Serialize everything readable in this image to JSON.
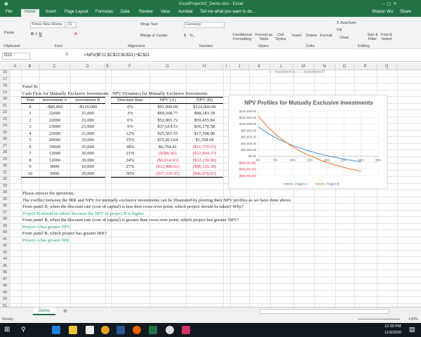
{
  "window": {
    "title": "ExcelProject#2_Demo.xlsx - Excel",
    "user": "Sharon Wu",
    "share": "Share"
  },
  "ribbon_tabs": [
    "File",
    "Home",
    "Insert",
    "Page Layout",
    "Formulas",
    "Data",
    "Review",
    "View",
    "Acrobat"
  ],
  "tell_me": "Tell me what you want to do...",
  "ribbon": {
    "paste": "Paste",
    "font_name": "Times New Roma",
    "font_size": "11",
    "wrap": "Wrap Text",
    "merge": "Merge & Center",
    "number_format": "Currency",
    "conditional": "Conditional Formatting",
    "format_table": "Format as Table",
    "cell_styles": "Cell Styles",
    "insert": "Insert",
    "delete": "Delete",
    "format": "Format",
    "autosum": "AutoSum",
    "fill": "Fill",
    "clear": "Clear",
    "sort": "Sort & Filter",
    "find": "Find & Select",
    "groups": [
      "Clipboard",
      "Font",
      "Alignment",
      "Number",
      "Styles",
      "Cells",
      "Editing"
    ]
  },
  "formula_bar": {
    "name_box": "G21",
    "formula": "=NPV($F21,$C$22:$C$31)+$C$21"
  },
  "columns": [
    "A",
    "B",
    "C",
    "D",
    "E",
    "F",
    "G",
    "H",
    "I",
    "J",
    "K",
    "L",
    "M",
    "N",
    "O",
    "P",
    "Q"
  ],
  "rows_start": 16,
  "rows_end": 51,
  "panel": {
    "label": "Panel B:",
    "left_title": "Cash Flow for Mutually Exclusive Investments",
    "right_title": "NPV Dynamics for Mutually Exclusive Investments",
    "left_headers": [
      "Year",
      "Investment A",
      "Investment B"
    ],
    "right_headers": [
      "Discount Rate",
      "NPV (A)",
      "NPV (B)"
    ],
    "rows": [
      [
        "0",
        "-$80,000",
        "-$120,000",
        "0%",
        "$91,000.00",
        "$124,000.00"
      ],
      [
        "1",
        "22000",
        "21,000",
        "3%",
        "$69,568.77",
        "$88,183.39"
      ],
      [
        "2",
        "22000",
        "21,000",
        "6%",
        "$52,065.72",
        "$59,455.84"
      ],
      [
        "3",
        "23000",
        "21,000",
        "9%",
        "$37,614.51",
        "$36,170.58"
      ],
      [
        "4",
        "23000",
        "21,000",
        "12%",
        "$25,561.55",
        "$17,108.90"
      ],
      [
        "5",
        "20000",
        "35,000",
        "15%",
        "$15,413.64",
        "$1,358.68"
      ],
      [
        "6",
        "19000",
        "35,000",
        "18%",
        "$6,794.41",
        "($11,770.03)"
      ],
      [
        "7",
        "12000",
        "30,000",
        "21%",
        "($586.42)",
        "($22,804.37)"
      ],
      [
        "8",
        "12000",
        "30,000",
        "24%",
        "($6,914.93)",
        "($32,150.96)"
      ],
      [
        "9",
        "9000",
        "10,000",
        "27%",
        "($12,488.92)",
        "($40,126.30)"
      ],
      [
        "10",
        "9000",
        "20,000",
        "30%",
        "($17,329.47)",
        "($46,978.83)"
      ]
    ]
  },
  "questions": [
    {
      "text": "Please answer the questions:",
      "answer": false
    },
    {
      "text": "The conflict between the IRR and NPV for mutually exclusive investmetns can be illustrated by plotting their NPV profiles as we have done above.",
      "answer": false
    },
    {
      "text": "From panel B, when the discount rate (cost of capital) is less then cross-over point, which project should be taken? Why?",
      "answer": false
    },
    {
      "text": "Project B should be taken. Because the NPV of project B is higher.",
      "answer": true
    },
    {
      "text": "From panel B, when the discount rate (cost of capital) is greater than cross-over point, which project has greater NPV?",
      "answer": false
    },
    {
      "text": "Project A has greater NPV.",
      "answer": true
    },
    {
      "text": "From panel B, which project has greater IRR?",
      "answer": false
    },
    {
      "text": "Project A has greater IRR.",
      "answer": true
    }
  ],
  "partial_legend": [
    "Investment A",
    "Investment B"
  ],
  "chart_data": {
    "type": "line",
    "title": "NPV Profiles for Mutually Exclusive Investments",
    "x": [
      0,
      3,
      6,
      9,
      12,
      15,
      18,
      21,
      24,
      27,
      30
    ],
    "x_ticks": [
      "0%",
      "5%",
      "10%",
      "15%",
      "20%",
      "25%",
      "30%",
      "35%"
    ],
    "y_ticks": [
      "$140,000.00",
      "$120,000.00",
      "$100,000.00",
      "$80,000.00",
      "$60,000.00",
      "$40,000.00",
      "$20,000.00",
      "$0.00",
      "($20,000.00)",
      "($40,000.00)",
      "($60,000.00)"
    ],
    "ylim": [
      -60000,
      140000
    ],
    "xlim": [
      0,
      35
    ],
    "series": [
      {
        "name": "Project A",
        "color": "#5b9bd5",
        "values": [
          91000,
          69568.77,
          52065.72,
          37614.51,
          25561.55,
          15413.64,
          6794.41,
          -586.42,
          -6914.93,
          -12488.92,
          -17329.47
        ]
      },
      {
        "name": "Project B",
        "color": "#ed7d31",
        "values": [
          124000,
          88183.39,
          59455.84,
          36170.58,
          17108.9,
          1358.68,
          -11770.03,
          -22804.37,
          -32150.96,
          -40126.3,
          -46978.83
        ]
      }
    ],
    "legend": "bottom"
  },
  "sheet_tabs": [
    "Demo"
  ],
  "status": {
    "ready": "Ready",
    "zoom": "100%"
  },
  "taskbar": {
    "time": "12:30 PM",
    "date": "11/3/2020"
  }
}
